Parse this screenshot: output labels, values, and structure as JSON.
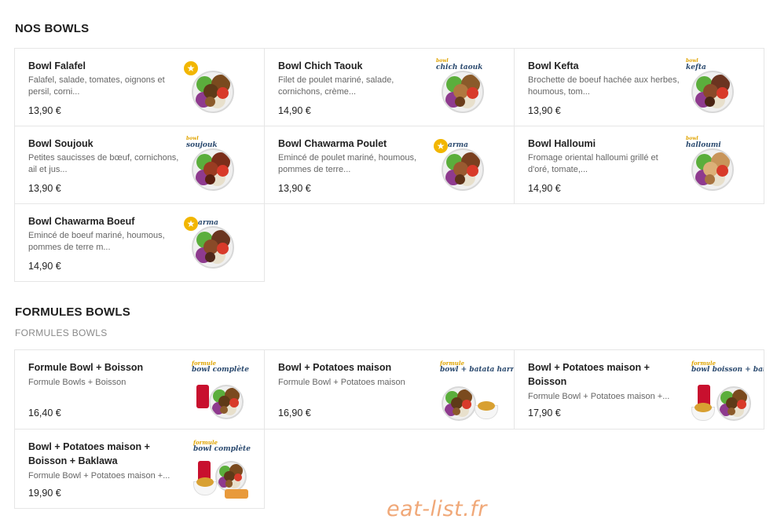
{
  "section1": {
    "title": "NOS BOWLS",
    "items": [
      {
        "name": "Bowl Falafel",
        "desc": "Falafel, salade, tomates, oignons et persil, corni...",
        "price": "13,90 €",
        "tag": "",
        "star": true,
        "food": "falafel"
      },
      {
        "name": "Bowl Chich Taouk",
        "desc": "Filet de poulet mariné, salade, cornichons, crème...",
        "price": "14,90 €",
        "tag": "chich taouk",
        "star": false,
        "food": "chicken"
      },
      {
        "name": "Bowl Kefta",
        "desc": "Brochette de boeuf hachée aux herbes, houmous, tom...",
        "price": "13,90 €",
        "tag": "kefta",
        "star": false,
        "food": "kefta"
      },
      {
        "name": "Bowl Soujouk",
        "desc": "Petites saucisses de bœuf, cornichons, ail et jus...",
        "price": "13,90 €",
        "tag": "soujouk",
        "star": false,
        "food": "soujouk"
      },
      {
        "name": "Bowl Chawarma Poulet",
        "desc": "Emincé de poulet mariné, houmous, pommes de terre...",
        "price": "13,90 €",
        "tag": "arma",
        "star": true,
        "food": "chawarma"
      },
      {
        "name": "Bowl Halloumi",
        "desc": "Fromage oriental halloumi grillé et d'oré, tomate,...",
        "price": "14,90 €",
        "tag": "halloumi",
        "star": false,
        "food": "halloumi"
      },
      {
        "name": "Bowl Chawarma Boeuf",
        "desc": "Emincé de boeuf mariné, houmous, pommes de terre m...",
        "price": "14,90 €",
        "tag": "arma",
        "star": true,
        "food": "beef"
      }
    ]
  },
  "section2": {
    "title": "FORMULES BOWLS",
    "subtitle": "FORMULES BOWLS",
    "items": [
      {
        "name": "Formule Bowl + Boisson",
        "desc": "Formule Bowls + Boisson",
        "price": "16,40 €",
        "tag_top": "formule",
        "tag": "bowl complète"
      },
      {
        "name": "Bowl + Potatoes maison",
        "desc": "Formule Bowl + Potatoes maison",
        "price": "16,90 €",
        "tag_top": "formule",
        "tag": "bowl + batata harra"
      },
      {
        "name": "Bowl + Potatoes maison + Boisson",
        "desc": "Formule Bowl + Potatoes maison +...",
        "price": "17,90 €",
        "tag_top": "formule",
        "tag": "bowl boisson + batata harra"
      },
      {
        "name": "Bowl + Potatoes maison + Boisson + Baklawa",
        "desc": "Formule Bowl + Potatoes maison +...",
        "price": "19,90 €",
        "tag_top": "formule",
        "tag": "bowl complète"
      }
    ]
  },
  "watermark": "eat-list.fr",
  "colors": {
    "star": "#f2b600",
    "brand_blue": "#2b4a6f",
    "watermark": "#f0a878"
  }
}
